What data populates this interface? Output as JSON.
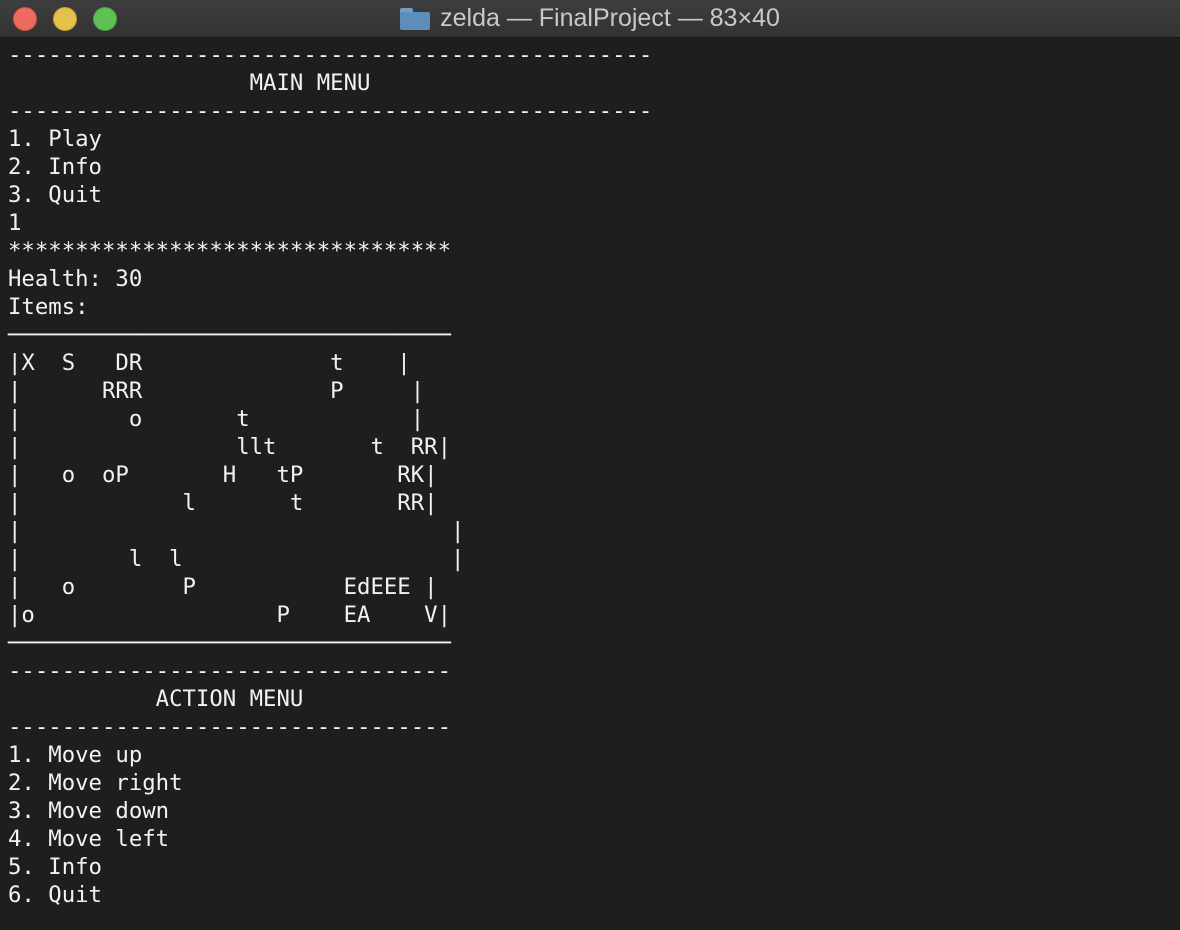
{
  "window": {
    "title": "zelda — FinalProject — 83×40",
    "folder_icon": "folder-icon"
  },
  "main_menu": {
    "rule_top": "------------------------------------------------",
    "title": "                  MAIN MENU",
    "rule_bottom": "------------------------------------------------",
    "options": [
      "1. Play",
      "2. Info",
      "3. Quit"
    ],
    "input": "1"
  },
  "status": {
    "stars": "*********************************",
    "health": "Health: 30",
    "items": "Items:"
  },
  "map": {
    "border_top": "─────────────────────────────────",
    "rows": [
      "|X  S   DR              t    |",
      "|      RRR              P     |",
      "|        o       t            |",
      "|                llt       t  RR|",
      "|   o  oP       H   tP       RK|",
      "|            l       t       RR|",
      "|                                |",
      "|        l  l                    |",
      "|   o        P           EdEEE |",
      "|o                  P    EA    V|"
    ],
    "border_bottom": "─────────────────────────────────"
  },
  "action_menu": {
    "rule_top": "---------------------------------",
    "title": "           ACTION MENU",
    "rule_bottom": "---------------------------------",
    "options": [
      "1. Move up",
      "2. Move right",
      "3. Move down",
      "4. Move left",
      "5. Info",
      "6. Quit"
    ]
  }
}
